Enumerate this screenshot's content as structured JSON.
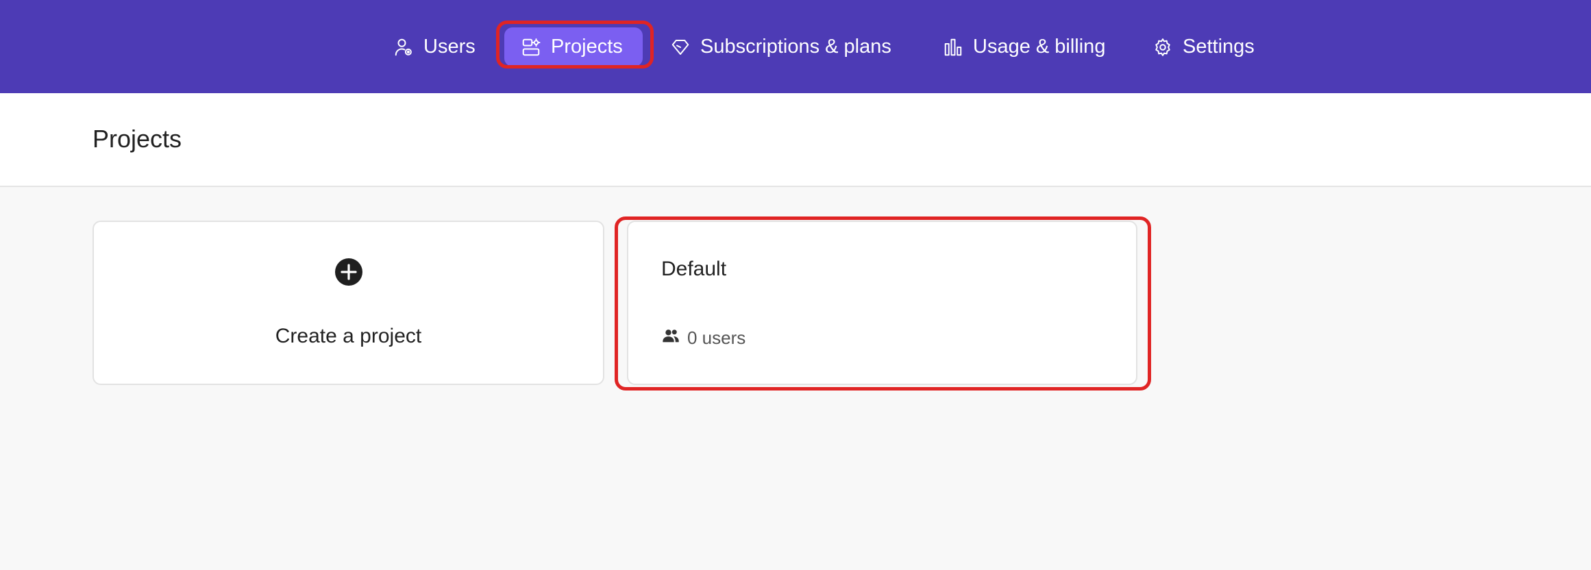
{
  "nav": {
    "items": [
      {
        "label": "Users",
        "icon": "user-gear-icon"
      },
      {
        "label": "Projects",
        "icon": "projects-icon",
        "active": true
      },
      {
        "label": "Subscriptions & plans",
        "icon": "diamond-icon"
      },
      {
        "label": "Usage & billing",
        "icon": "bar-chart-icon"
      },
      {
        "label": "Settings",
        "icon": "gear-icon"
      }
    ]
  },
  "page": {
    "title": "Projects"
  },
  "cards": {
    "create": {
      "label": "Create a project",
      "icon": "plus-circle-icon"
    },
    "projects": [
      {
        "name": "Default",
        "users_text": "0 users",
        "icon": "users-icon"
      }
    ]
  },
  "colors": {
    "nav_bg": "#4d3bb5",
    "nav_active": "#7b5ff1",
    "highlight": "#e02424",
    "page_bg": "#f8f8f8"
  }
}
